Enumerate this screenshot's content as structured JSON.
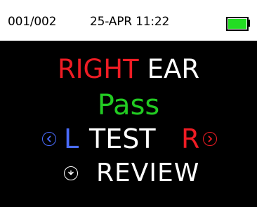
{
  "status_bar": {
    "record_counter": "001/002",
    "datetime": "25-APR 11:22",
    "battery_level": 1.0,
    "battery_color": "#22dd22"
  },
  "ear": {
    "side": "RIGHT",
    "word": "EAR",
    "side_color": "#ee1c24"
  },
  "result": {
    "text": "Pass",
    "color": "#22cc22"
  },
  "navigation": {
    "left_icon": "chevron-left-icon",
    "left_label": "L",
    "left_color": "#4a6cff",
    "test_label": "TEST",
    "right_label": "R",
    "right_icon": "chevron-right-icon",
    "right_color": "#ee1c24"
  },
  "review": {
    "icon": "chevron-down-icon",
    "label": "REVIEW"
  }
}
